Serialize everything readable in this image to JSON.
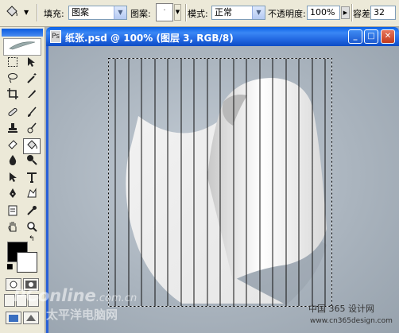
{
  "options_bar": {
    "fill_label": "填充:",
    "fill_value": "图案",
    "pattern_label": "图案:",
    "mode_label": "模式:",
    "mode_value": "正常",
    "opacity_label": "不透明度:",
    "opacity_value": "100%",
    "tolerance_label": "容差:",
    "tolerance_value": "32"
  },
  "document": {
    "title": "纸张.psd @ 100% (图层 3, RGB/8)",
    "window_buttons": {
      "minimize": "_",
      "maximize": "□",
      "close": "✕"
    }
  },
  "watermarks": {
    "pconline": "PConline",
    "pconline_domain": ".com.cn",
    "pconline_cn": "太平洋电脑网",
    "site_cn": "中国 365 设计网",
    "site_url": "www.cn365design.com"
  },
  "colors": {
    "foreground": "#000000",
    "background": "#ffffff",
    "titlebar": "#1f64de"
  },
  "icons": [
    "marquee-icon",
    "move-icon",
    "lasso-icon",
    "magic-wand-icon",
    "crop-icon",
    "slice-icon",
    "healing-brush-icon",
    "brush-icon",
    "clone-stamp-icon",
    "history-brush-icon",
    "eraser-icon",
    "paint-bucket-icon",
    "blur-icon",
    "dodge-icon",
    "path-selection-icon",
    "type-icon",
    "pen-icon",
    "custom-shape-icon",
    "notes-icon",
    "eyedropper-icon",
    "hand-icon",
    "zoom-icon"
  ]
}
